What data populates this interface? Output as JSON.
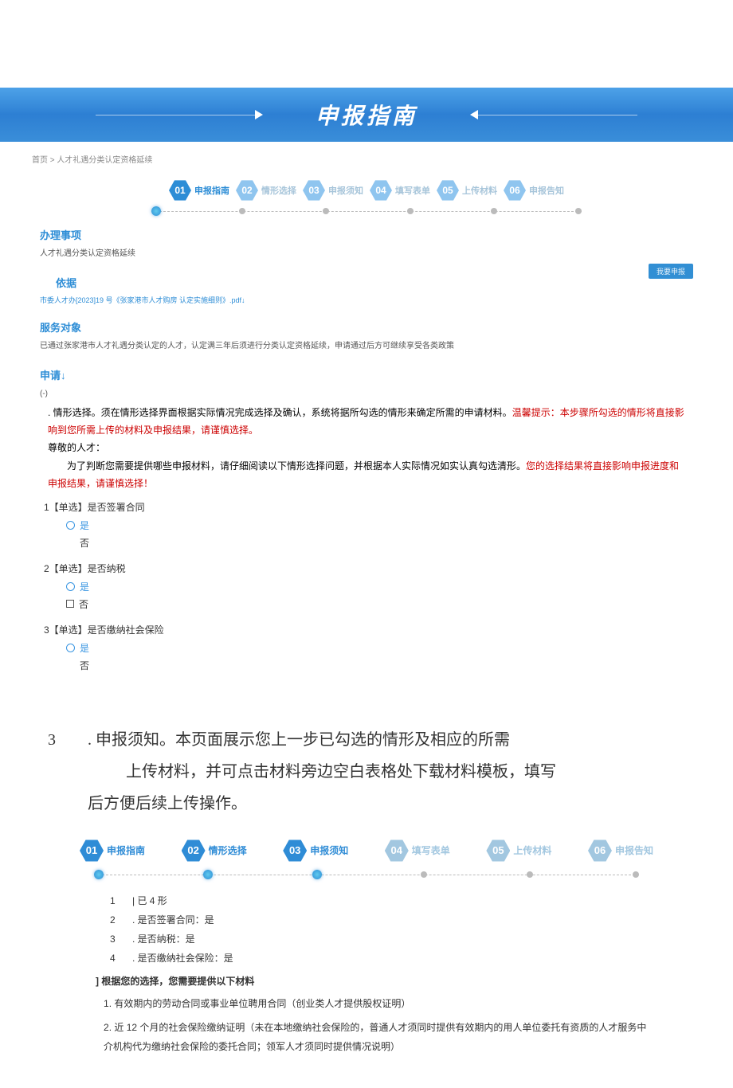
{
  "banner": {
    "title": "申报指南"
  },
  "breadcrumb": "首页 > 人才礼遇分类认定资格延续",
  "steps": [
    {
      "num": "01",
      "label": "申报指南"
    },
    {
      "num": "02",
      "label": "情形选择"
    },
    {
      "num": "03",
      "label": "申报须知"
    },
    {
      "num": "04",
      "label": "填写表单"
    },
    {
      "num": "05",
      "label": "上传材料"
    },
    {
      "num": "06",
      "label": "申报告知"
    }
  ],
  "section_item": {
    "title": "办理事项",
    "text": "人才礼遇分类认定资格延续"
  },
  "section_basis": {
    "title": "依据",
    "link": "市委人才办[2023]19 号《张家港市人才购房 认定实施细则》.pdf↓"
  },
  "apply_btn": "我要申报",
  "section_target": {
    "title": "服务对象",
    "text": "已通过张家港市人才礼遇分类认定的人才，认定满三年后须进行分类认定资格延续，申请通过后方可继续享受各类政策"
  },
  "section_apply": {
    "title": "申请↓",
    "sub": "(-)"
  },
  "notice": {
    "p1_black1": ". 情形选择。须在情形选择界面根据实际情况完成选择及确认，系统将据所勾选的情形来确定所需的申请材料。",
    "p1_red": "温馨提示：本步骤所勾选的情形将直接影响到您所需上传的材料及申报结果，请谨慎选择。",
    "p2": "尊敬的人才：",
    "p3_black": "　　为了判断您需要提供哪些申报材料，请仔细阅读以下情形选择问题，并根据本人实际情况如实认真勾选清形。",
    "p3_red": "您的选择结果将直接影响申报进度和申报结果，请谨慎选择！"
  },
  "questions": [
    {
      "title": "1【单选】是否签署合同",
      "yes": "是",
      "no": "否",
      "no_style": "plain"
    },
    {
      "title": "2【单选】是否纳税",
      "yes": "是",
      "no": "否",
      "no_style": "checkbox"
    },
    {
      "title": "3【单选】是否缴纳社会保险",
      "yes": "是",
      "no": "否",
      "no_style": "plain"
    }
  ],
  "body": {
    "num": "3",
    "line1": ". 申报须知。本页面展示您上一步已勾选的情形及相应的所需",
    "line2": "上传材料，并可点击材料旁边空白表格处下载材料模板，填写",
    "line3": "后方便后续上传操作。"
  },
  "lower": {
    "selected_header": "| 已 4 形",
    "items": [
      ". 是否签署合同：是",
      ". 是否纳税：是",
      ". 是否缴纳社会保险：是"
    ],
    "materials_header": "] 根据您的选择，您需要提供以下材料",
    "materials": [
      ". 有效期内的劳动合同或事业单位聘用合同（创业类人才提供股权证明）",
      ". 近 12 个月的社会保险缴纳证明（未在本地缴纳社会保险的，普通人才须同时提供有效期内的用人单位委托有资质的人才服务中介机构代为缴纳社会保险的委托合同；领军人才须同时提供情况说明）"
    ]
  }
}
